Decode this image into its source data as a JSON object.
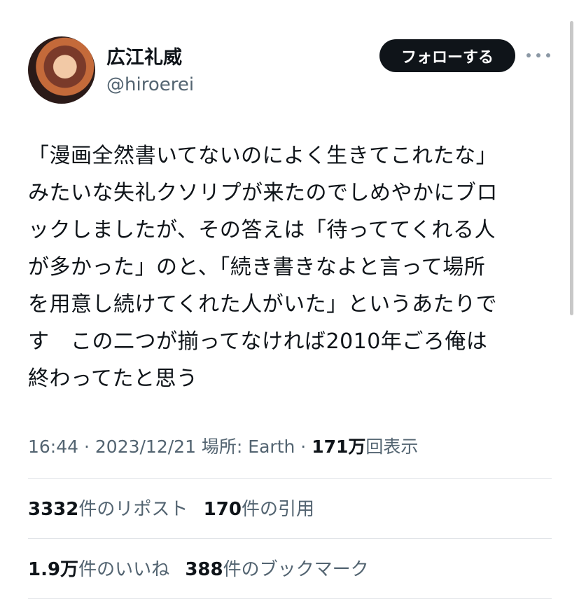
{
  "user": {
    "display_name": "広江礼威",
    "handle": "@hiroerei",
    "avatar": "user-avatar-image"
  },
  "follow_button": {
    "label": "フォローする"
  },
  "more_menu": {
    "icon": "more-horizontal-icon"
  },
  "tweet": {
    "lines": [
      "「漫画全然書いてないのによく生きてこれたな」",
      "みたいな失礼クソリプが来たのでしめやかにブロ",
      "ックしましたが、その答えは「待っててくれる人",
      "が多かった」のと、「続き書きなよと言って場所",
      "を用意し続けてくれた人がいた」というあたりで",
      "す　この二つが揃ってなければ2010年ごろ俺は",
      "終わってたと思う"
    ]
  },
  "meta": {
    "time": "16:44",
    "sep1": " · ",
    "date": "2023/12/21",
    "location": " 場所: Earth",
    "sep2": " · ",
    "views_count": "171万",
    "views_label": "回表示"
  },
  "stats": {
    "reposts_count": "3332",
    "reposts_label": "件のリポスト",
    "quotes_count": "170",
    "quotes_label": "件の引用",
    "likes_count": "1.9万",
    "likes_label": "件のいいね",
    "bookmarks_count": "388",
    "bookmarks_label": "件のブックマーク"
  }
}
